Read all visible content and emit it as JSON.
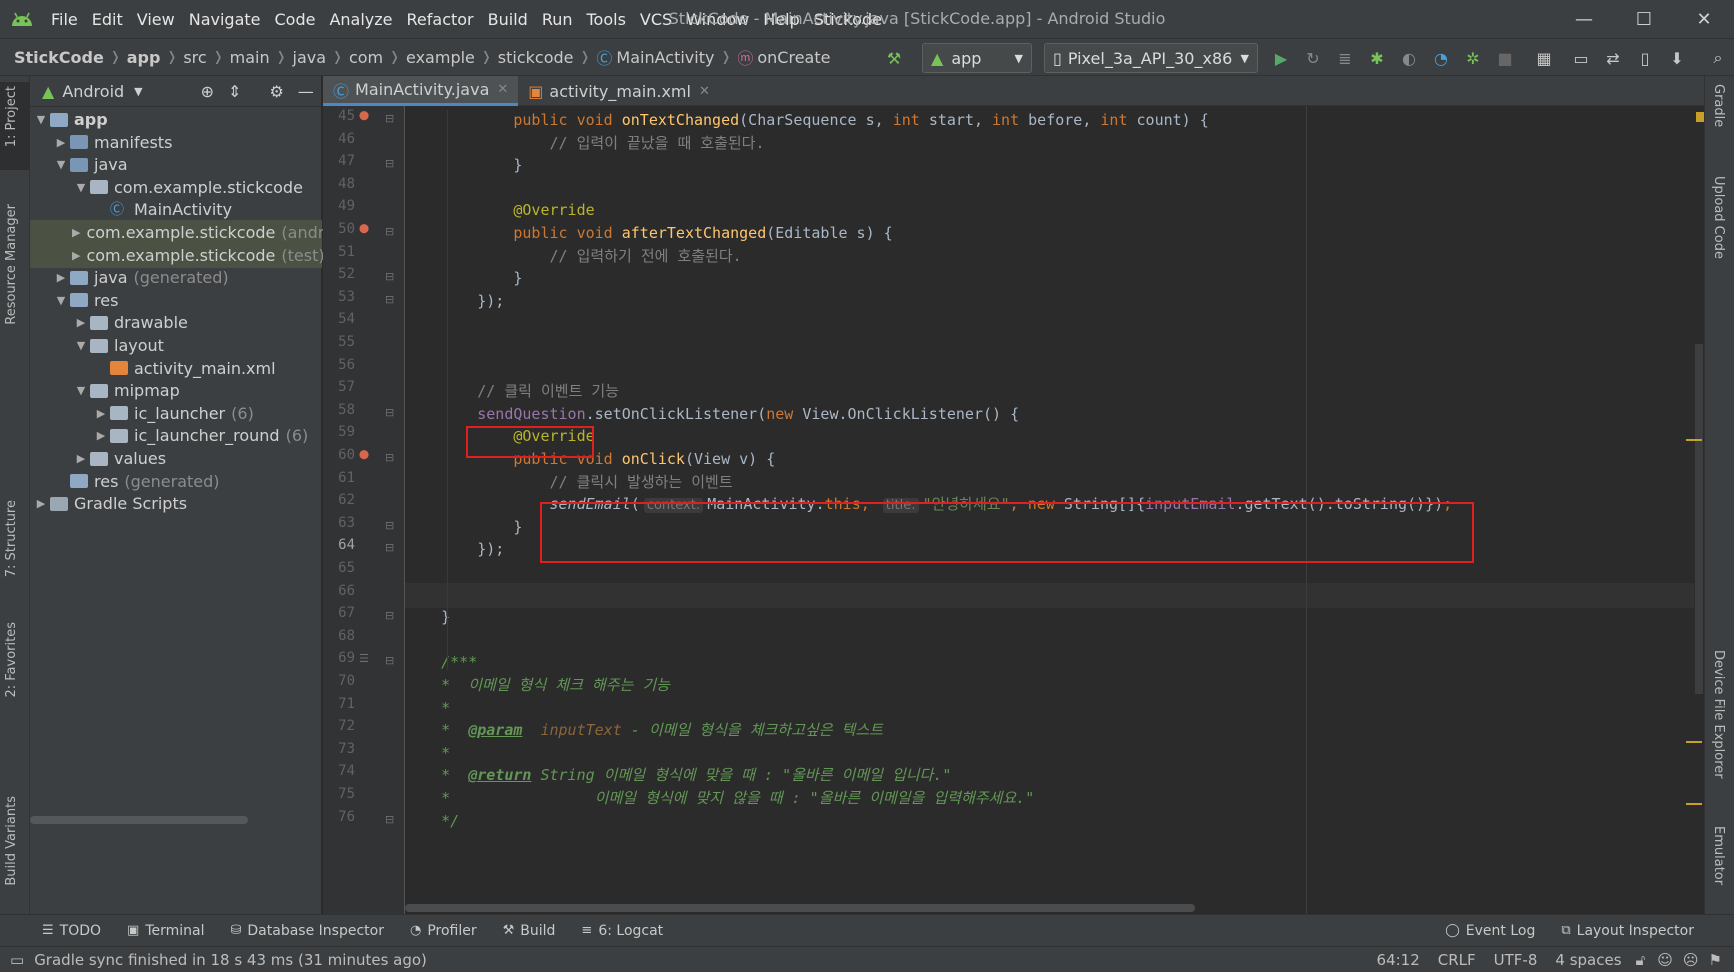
{
  "menubar": {
    "items": [
      "File",
      "Edit",
      "View",
      "Navigate",
      "Code",
      "Analyze",
      "Refactor",
      "Build",
      "Run",
      "Tools",
      "VCS",
      "Window",
      "Help",
      "Stickode"
    ],
    "window_title": "StickCode - MainActivity.java [StickCode.app] - Android Studio"
  },
  "navbar": {
    "crumbs": [
      "StickCode",
      "app",
      "src",
      "main",
      "java",
      "com",
      "example",
      "stickcode",
      "MainActivity",
      "onCreate"
    ],
    "run_config": "app",
    "device": "Pixel_3a_API_30_x86"
  },
  "left_strip": [
    "1: Project",
    "Resource Manager",
    "7: Structure",
    "2: Favorites",
    "Build Variants"
  ],
  "right_strip": [
    "Gradle",
    "Upload Code",
    "Device File Explorer",
    "Emulator"
  ],
  "project": {
    "view_mode": "Android",
    "tree": [
      {
        "label": "app",
        "depth": 0,
        "arrow": "▼",
        "icon": "module",
        "bold": true
      },
      {
        "label": "manifests",
        "depth": 1,
        "arrow": "▶",
        "icon": "folder-blue"
      },
      {
        "label": "java",
        "depth": 1,
        "arrow": "▼",
        "icon": "folder-blue"
      },
      {
        "label": "com.example.stickcode",
        "depth": 2,
        "arrow": "▼",
        "icon": "package"
      },
      {
        "label": "MainActivity",
        "depth": 3,
        "arrow": "",
        "icon": "class"
      },
      {
        "label": "com.example.stickcode",
        "suffix": "(andr",
        "depth": 2,
        "arrow": "▶",
        "icon": "package",
        "selected": true
      },
      {
        "label": "com.example.stickcode",
        "suffix": "(test)",
        "depth": 2,
        "arrow": "▶",
        "icon": "package",
        "selected": true
      },
      {
        "label": "java",
        "suffix": "(generated)",
        "depth": 1,
        "arrow": "▶",
        "icon": "folder-gen"
      },
      {
        "label": "res",
        "depth": 1,
        "arrow": "▼",
        "icon": "folder-res"
      },
      {
        "label": "drawable",
        "depth": 2,
        "arrow": "▶",
        "icon": "package"
      },
      {
        "label": "layout",
        "depth": 2,
        "arrow": "▼",
        "icon": "package"
      },
      {
        "label": "activity_main.xml",
        "depth": 3,
        "arrow": "",
        "icon": "xml"
      },
      {
        "label": "mipmap",
        "depth": 2,
        "arrow": "▼",
        "icon": "package"
      },
      {
        "label": "ic_launcher",
        "suffix": "(6)",
        "depth": 3,
        "arrow": "▶",
        "icon": "package"
      },
      {
        "label": "ic_launcher_round",
        "suffix": "(6)",
        "depth": 3,
        "arrow": "▶",
        "icon": "package"
      },
      {
        "label": "values",
        "depth": 2,
        "arrow": "▶",
        "icon": "package"
      },
      {
        "label": "res",
        "suffix": "(generated)",
        "depth": 1,
        "arrow": "",
        "icon": "folder-res"
      },
      {
        "label": "Gradle Scripts",
        "depth": 0,
        "arrow": "▶",
        "icon": "gradle"
      }
    ]
  },
  "tabs": [
    {
      "label": "MainActivity.java",
      "active": true
    },
    {
      "label": "activity_main.xml",
      "active": false
    }
  ],
  "code": {
    "current_line": 64,
    "lines": [
      {
        "n": 45,
        "mark": "override",
        "tokens": [
          [
            "",
            "            "
          ],
          [
            "kw",
            "public void "
          ],
          [
            "fn",
            "onTextChanged"
          ],
          [
            "",
            "(CharSequence s, "
          ],
          [
            "kw",
            "int "
          ],
          [
            "",
            "start, "
          ],
          [
            "kw",
            "int "
          ],
          [
            "",
            "before, "
          ],
          [
            "kw",
            "int "
          ],
          [
            "",
            "count) {"
          ]
        ]
      },
      {
        "n": 46,
        "tokens": [
          [
            "",
            "                "
          ],
          [
            "cm",
            "// 입력이 끝났을 때 호출된다."
          ]
        ]
      },
      {
        "n": 47,
        "tokens": [
          [
            "",
            "            }"
          ]
        ]
      },
      {
        "n": 48,
        "tokens": []
      },
      {
        "n": 49,
        "tokens": [
          [
            "",
            "            "
          ],
          [
            "an",
            "@Override"
          ]
        ]
      },
      {
        "n": 50,
        "mark": "override",
        "tokens": [
          [
            "",
            "            "
          ],
          [
            "kw",
            "public void "
          ],
          [
            "fn",
            "afterTextChanged"
          ],
          [
            "",
            "(Editable s) {"
          ]
        ]
      },
      {
        "n": 51,
        "tokens": [
          [
            "",
            "                "
          ],
          [
            "cm",
            "// 입력하기 전에 호출된다."
          ]
        ]
      },
      {
        "n": 52,
        "tokens": [
          [
            "",
            "            }"
          ]
        ]
      },
      {
        "n": 53,
        "tokens": [
          [
            "",
            "        });"
          ]
        ]
      },
      {
        "n": 54,
        "tokens": []
      },
      {
        "n": 55,
        "tokens": []
      },
      {
        "n": 56,
        "tokens": []
      },
      {
        "n": 57,
        "tokens": [
          [
            "",
            "        "
          ],
          [
            "cm",
            "// 클릭 이벤트 기능"
          ]
        ]
      },
      {
        "n": 58,
        "tokens": [
          [
            "",
            "        "
          ],
          [
            "fld",
            "sendQuestion"
          ],
          [
            "",
            ".setOnClickListener("
          ],
          [
            "kw",
            "new "
          ],
          [
            "",
            "View.OnClickListener() {"
          ]
        ]
      },
      {
        "n": 59,
        "tokens": [
          [
            "",
            "            "
          ],
          [
            "an",
            "@Override"
          ]
        ]
      },
      {
        "n": 60,
        "mark": "override",
        "tokens": [
          [
            "",
            "            "
          ],
          [
            "kw",
            "public void "
          ],
          [
            "fn",
            "onClick"
          ],
          [
            "",
            "(View v) {"
          ]
        ]
      },
      {
        "n": 61,
        "tokens": [
          [
            "",
            "                "
          ],
          [
            "cm",
            "// 클릭시 발생하는 이벤트"
          ]
        ]
      },
      {
        "n": 62,
        "tokens": [
          [
            "",
            "                "
          ],
          [
            "it",
            "sendEmail"
          ],
          [
            "",
            "("
          ],
          [
            "hint",
            "context:"
          ],
          [
            "",
            "MainActivity."
          ],
          [
            "kw",
            "this"
          ],
          [
            "kw",
            ", "
          ],
          [
            "hint",
            "title:"
          ],
          [
            "str",
            "\"안녕하세요\""
          ],
          [
            "kw",
            ", new "
          ],
          [
            "",
            "String[]{"
          ],
          [
            "fld",
            "inputEmail"
          ],
          [
            "",
            ".getText().toString()})"
          ],
          [
            "kw",
            ";"
          ]
        ]
      },
      {
        "n": 63,
        "tokens": [
          [
            "",
            "            }"
          ]
        ]
      },
      {
        "n": 64,
        "tokens": [
          [
            "",
            "        });"
          ]
        ]
      },
      {
        "n": 65,
        "tokens": []
      },
      {
        "n": 66,
        "tokens": []
      },
      {
        "n": 67,
        "tokens": [
          [
            "",
            "    }"
          ]
        ]
      },
      {
        "n": 68,
        "tokens": []
      },
      {
        "n": 69,
        "mark": "doc",
        "tokens": [
          [
            "",
            "    "
          ],
          [
            "dc",
            "/***"
          ]
        ]
      },
      {
        "n": 70,
        "tokens": [
          [
            "",
            "    "
          ],
          [
            "dc",
            "*  이메일 형식 체크 해주는 기능"
          ]
        ]
      },
      {
        "n": 71,
        "tokens": [
          [
            "",
            "    "
          ],
          [
            "dc",
            "*"
          ]
        ]
      },
      {
        "n": 72,
        "tokens": [
          [
            "",
            "    "
          ],
          [
            "dc",
            "*  "
          ],
          [
            "dtag",
            "@param"
          ],
          [
            "dc",
            "  "
          ],
          [
            "dpar",
            "inputText"
          ],
          [
            "dc",
            " - 이메일 형식을 체크하고싶은 텍스트"
          ]
        ]
      },
      {
        "n": 73,
        "tokens": [
          [
            "",
            "    "
          ],
          [
            "dc",
            "*"
          ]
        ]
      },
      {
        "n": 74,
        "tokens": [
          [
            "",
            "    "
          ],
          [
            "dc",
            "*  "
          ],
          [
            "dtag",
            "@return"
          ],
          [
            "dc",
            " String 이메일 형식에 맞을 때 : \"올바른 이메일 입니다.\""
          ]
        ]
      },
      {
        "n": 75,
        "tokens": [
          [
            "",
            "    "
          ],
          [
            "dc",
            "*                이메일 형식에 맞지 않을 때 : \"올바른 이메일을 입력해주세요.\""
          ]
        ]
      },
      {
        "n": 76,
        "tokens": [
          [
            "",
            "    "
          ],
          [
            "dc",
            "*/"
          ]
        ]
      }
    ]
  },
  "bottom_tools": [
    {
      "icon": "☰",
      "label": "TODO"
    },
    {
      "icon": "▣",
      "label": "Terminal"
    },
    {
      "icon": "⛁",
      "label": "Database Inspector"
    },
    {
      "icon": "◔",
      "label": "Profiler"
    },
    {
      "icon": "⚒",
      "label": "Build"
    },
    {
      "icon": "≡",
      "label": "6: Logcat"
    }
  ],
  "bottom_right_tools": [
    {
      "icon": "◯",
      "label": "Event Log"
    },
    {
      "icon": "⧉",
      "label": "Layout Inspector"
    }
  ],
  "status": {
    "message": "Gradle sync finished in 18 s 43 ms (31 minutes ago)",
    "position": "64:12",
    "line_sep": "CRLF",
    "encoding": "UTF-8",
    "indent": "4 spaces"
  },
  "colors": {
    "accent": "#4a88c7",
    "highlight_box": "#e02020",
    "android_green": "#78c257"
  }
}
